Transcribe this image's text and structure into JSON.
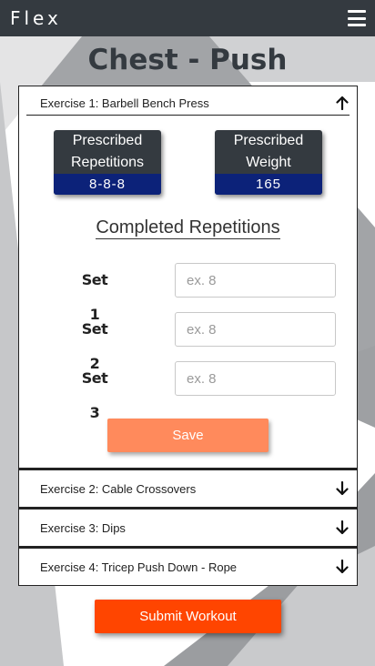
{
  "navbar": {
    "brand": "Flex",
    "menu_icon": "hamburger-menu-icon"
  },
  "page": {
    "title": "Chest - Push"
  },
  "exercises": [
    {
      "label": "Exercise 1: Barbell Bench Press",
      "expanded": true,
      "arrow_icon": "arrow-up-icon",
      "prescribed_repetitions": {
        "label_line1": "Prescribed",
        "label_line2": "Repetitions",
        "value": "8-8-8"
      },
      "prescribed_weight": {
        "label_line1": "Prescribed",
        "label_line2": "Weight",
        "value": "165"
      },
      "completed_title": "Completed Repetitions",
      "sets": [
        {
          "label": "Set 1",
          "value": "",
          "placeholder": "ex. 8"
        },
        {
          "label": "Set 2",
          "value": "",
          "placeholder": "ex. 8"
        },
        {
          "label": "Set 3",
          "value": "",
          "placeholder": "ex. 8"
        }
      ],
      "save_label": "Save"
    },
    {
      "label": "Exercise 2: Cable Crossovers",
      "expanded": false,
      "arrow_icon": "arrow-down-icon"
    },
    {
      "label": "Exercise 3: Dips",
      "expanded": false,
      "arrow_icon": "arrow-down-icon"
    },
    {
      "label": "Exercise 4: Tricep Push Down - Rope",
      "expanded": false,
      "arrow_icon": "arrow-down-icon"
    }
  ],
  "submit_label": "Submit Workout",
  "colors": {
    "navbar": "#343a40",
    "card_value_bg": "#0c2279",
    "save_button": "#ff8a5c",
    "submit_button": "#ff4500",
    "background_gray_dark": "#9ea0a3",
    "background_gray_light": "#d5d6d7"
  }
}
